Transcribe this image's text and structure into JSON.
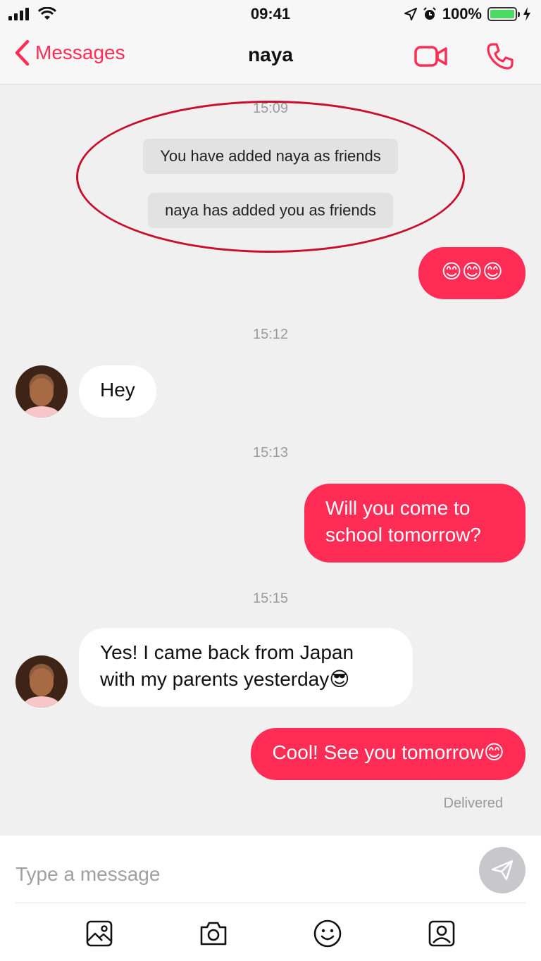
{
  "status_bar": {
    "time": "09:41",
    "battery_percent": "100%",
    "battery_level": 1.0,
    "icons": [
      "signal-icon",
      "wifi-icon",
      "location-icon",
      "alarm-icon",
      "battery-icon",
      "charging-icon"
    ]
  },
  "nav": {
    "back_label": "Messages",
    "title": "naya",
    "actions": [
      "video-call-icon",
      "phone-call-icon"
    ]
  },
  "colors": {
    "accent": "#ff2d55",
    "highlight_ring": "#c8102e",
    "incoming_bubble": "#ffffff",
    "background": "#f0f0f0"
  },
  "chat": {
    "timestamps": [
      "15:09",
      "15:12",
      "15:13",
      "15:15"
    ],
    "system_messages": [
      "You have added naya as friends",
      "naya has added you as friends"
    ],
    "messages": [
      {
        "direction": "out",
        "text": "😊😊😊"
      },
      {
        "direction": "in",
        "text": "Hey"
      },
      {
        "direction": "out",
        "text": "Will you come to school tomorrow?"
      },
      {
        "direction": "in",
        "text": "Yes! I came back from Japan with my parents yesterday😎"
      },
      {
        "direction": "out",
        "text": "Cool! See you tomorrow😊"
      }
    ],
    "delivery_status": "Delivered"
  },
  "composer": {
    "placeholder": "Type a message",
    "value": "",
    "toolbar": [
      "image-icon",
      "camera-icon",
      "emoji-icon",
      "contact-card-icon"
    ]
  }
}
